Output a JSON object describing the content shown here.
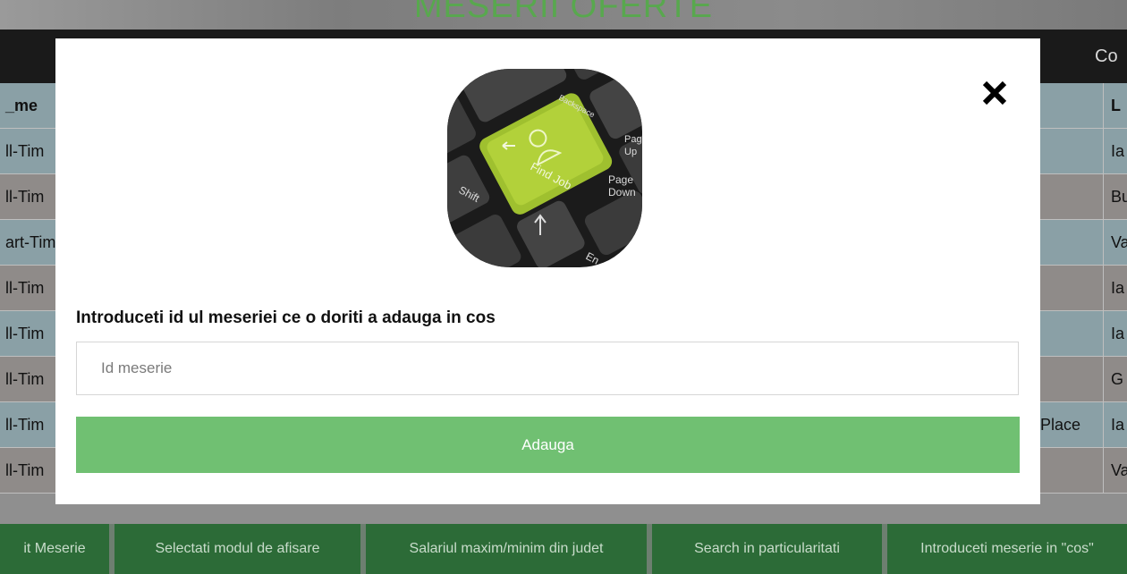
{
  "page": {
    "title": "MESERII OFERTE"
  },
  "table": {
    "header_left": "_me",
    "header_right": "L",
    "top_right": "Co",
    "rows": [
      {
        "left": "ll-Tim",
        "right": "Ia",
        "style": "alt1"
      },
      {
        "left": "ll-Tim",
        "right": "Bu",
        "style": "alt2"
      },
      {
        "left": "art-Tim",
        "right": "Va",
        "style": "alt1"
      },
      {
        "left": "ll-Tim",
        "right": "Ia",
        "style": "alt2"
      },
      {
        "left": "ll-Tim",
        "right": "Ia",
        "style": "alt1"
      },
      {
        "left": "ll-Tim",
        "right": "G",
        "style": "alt2"
      },
      {
        "left": "ll-Tim",
        "right": "Ia",
        "style": "alt1",
        "extra": "Place"
      },
      {
        "left": "ll-Tim",
        "right": "Va",
        "style": "alt2"
      }
    ]
  },
  "bottom_nav": [
    {
      "label": "it Meserie",
      "name": "nav-edit-meserie"
    },
    {
      "label": "Selectati modul de afisare",
      "name": "nav-display-mode"
    },
    {
      "label": "Salariul maxim/minim din judet",
      "name": "nav-salary-minmax"
    },
    {
      "label": "Search in particularitati",
      "name": "nav-search-particularities"
    },
    {
      "label": "Introduceti meserie in \"cos\"",
      "name": "nav-add-to-cart"
    }
  ],
  "modal": {
    "image_keys": {
      "main": "Find Job",
      "backspace": "Backspace",
      "pgup_1": "Pag",
      "pgup_2": "Up",
      "pgdn_1": "Page",
      "pgdn_2": "Down",
      "shift": "Shift",
      "end": "En"
    },
    "prompt": "Introduceti id ul meseriei ce o doriti a adauga in cos",
    "input_placeholder": "Id meserie",
    "input_value": "",
    "add_button": "Adauga",
    "close_icon": "close-icon"
  },
  "colors": {
    "accent_green": "#70c072",
    "nav_green": "#2c6b37",
    "key_green": "#9fc02f"
  }
}
